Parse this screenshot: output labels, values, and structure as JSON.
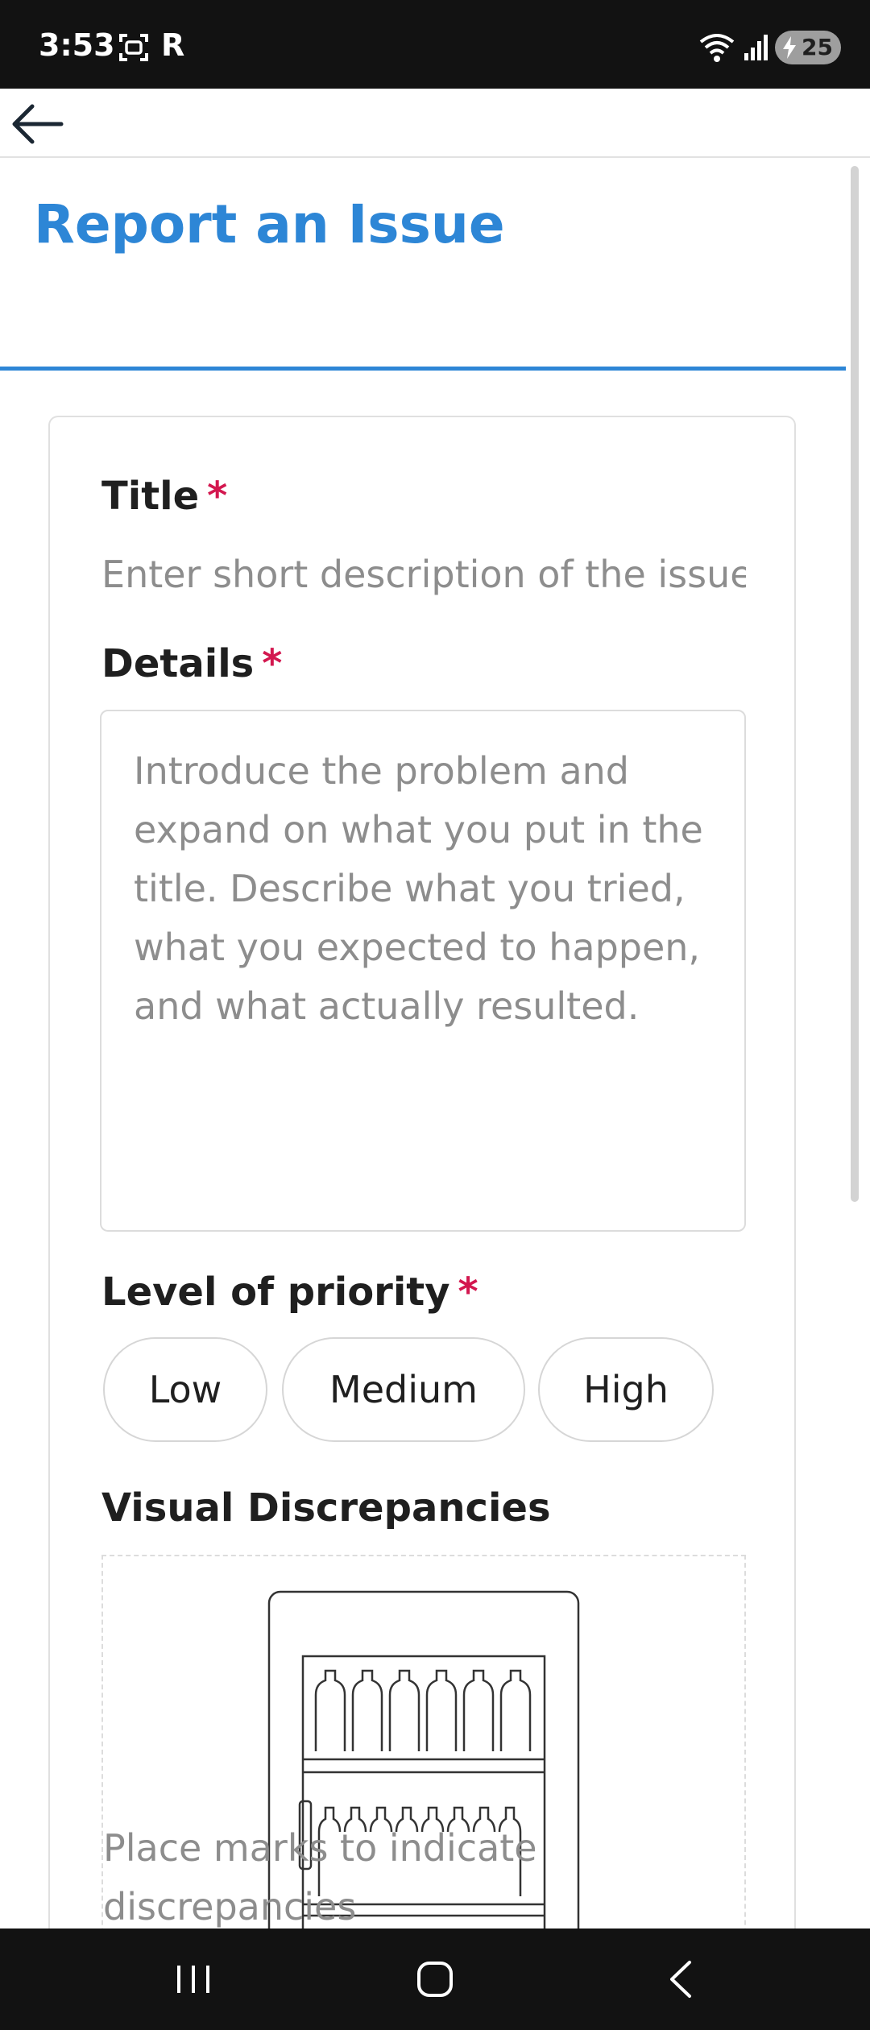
{
  "status_bar": {
    "time": "3:53",
    "carrier_letter": "R",
    "battery_level": "25",
    "icons": [
      "screenshot-icon",
      "wifi-icon",
      "signal-icon",
      "charging-icon"
    ]
  },
  "app_bar": {
    "back_icon": "arrow-left-icon"
  },
  "page": {
    "title": "Report an Issue",
    "accent_color": "#2d86d6",
    "required_color": "#d3174f"
  },
  "form": {
    "title_label": "Title",
    "title_placeholder": "Enter short description of the issue",
    "details_label": "Details",
    "details_placeholder": "Introduce the problem and expand on what you put in the title. Describe what you tried, what you expected to happen, and what actually resulted.",
    "priority_label": "Level of priority",
    "priority_options": [
      "Low",
      "Medium",
      "High"
    ],
    "visual_label": "Visual Discrepancies",
    "visual_hint": "Place marks to indicate discrepancies",
    "required_marker": "*"
  },
  "nav_bar": {
    "icons": [
      "recent-apps-icon",
      "home-icon",
      "back-nav-icon"
    ]
  }
}
